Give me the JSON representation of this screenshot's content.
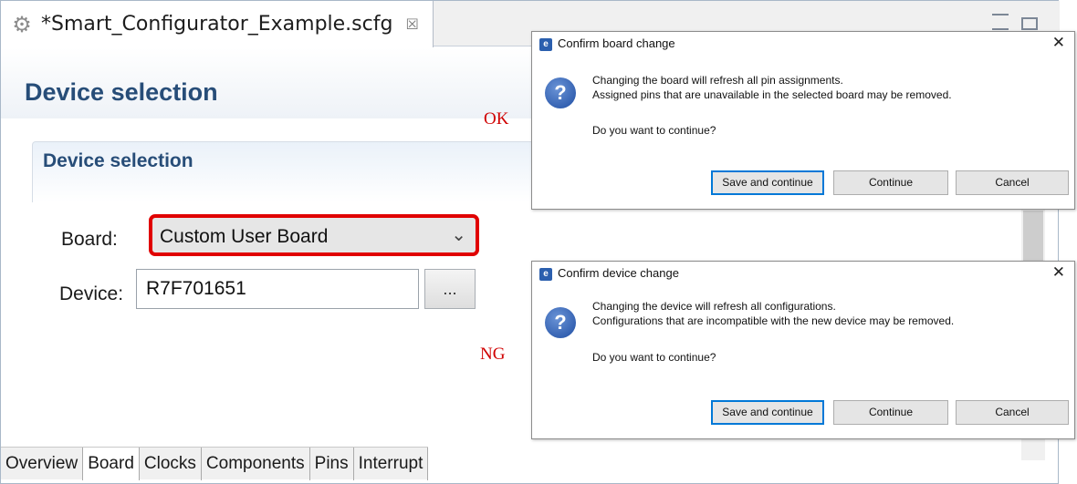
{
  "editor": {
    "file_tab": "*Smart_Configurator_Example.scfg",
    "tab_close": "☒",
    "page_title": "Device selection",
    "section_title": "Device selection",
    "board_label": "Board:",
    "board_value": "Custom User Board",
    "device_label": "Device:",
    "device_value": "R7F701651",
    "browse_label": "...",
    "bottom_tabs": [
      "Overview",
      "Board",
      "Clocks",
      "Components",
      "Pins",
      "Interrupt"
    ],
    "active_tab": "Board"
  },
  "dialogs": [
    {
      "title": "Confirm board change",
      "line1": "Changing the board will refresh all pin assignments.",
      "line2": "Assigned pins that are unavailable in the selected board may be removed.",
      "question": "Do you want to continue?",
      "buttons": [
        "Save and continue",
        "Continue",
        "Cancel"
      ]
    },
    {
      "title": "Confirm device change",
      "line1": "Changing the device will refresh all configurations.",
      "line2": "Configurations that are incompatible with the new device may be removed.",
      "question": "Do you want to continue?",
      "buttons": [
        "Save and continue",
        "Continue",
        "Cancel"
      ]
    }
  ],
  "annotations": {
    "ok": "OK",
    "ng": "NG",
    "ok_color": "#d00000",
    "highlight_color": "#e00000"
  },
  "icons": [
    "settings-gear-icon",
    "close-icon",
    "question-icon",
    "app-icon",
    "chevron-down-icon"
  ]
}
